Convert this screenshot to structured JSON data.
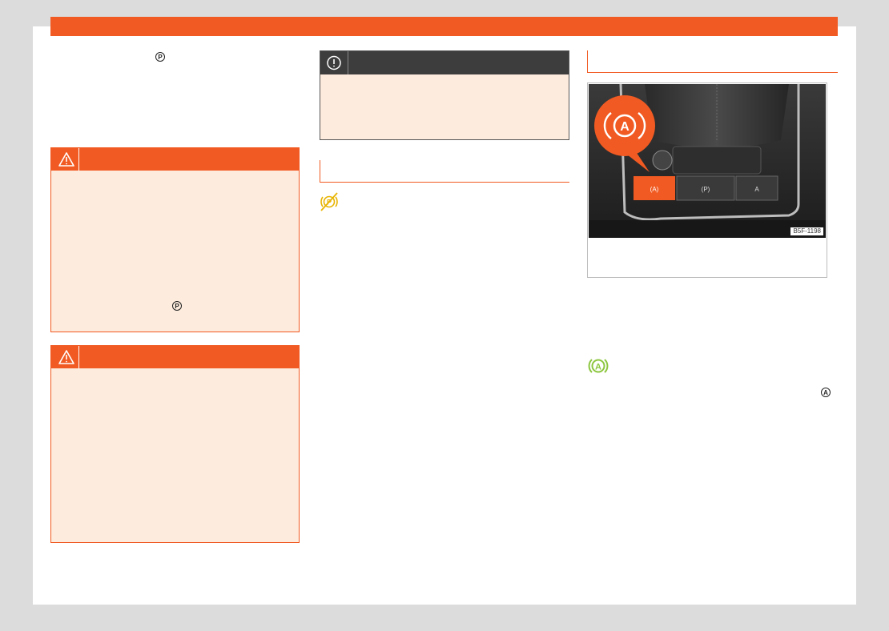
{
  "colors": {
    "accent": "#f15a22",
    "box_fill": "#fdebdd",
    "caution_header": "#3d3d3d",
    "indicator_yellow": "#e8b400",
    "indicator_green": "#8cc63f"
  },
  "icons": {
    "parking_brake": "P",
    "auto_hold": "A"
  },
  "figure": {
    "code": "B5F-1198",
    "callout_symbol": "((A))"
  }
}
